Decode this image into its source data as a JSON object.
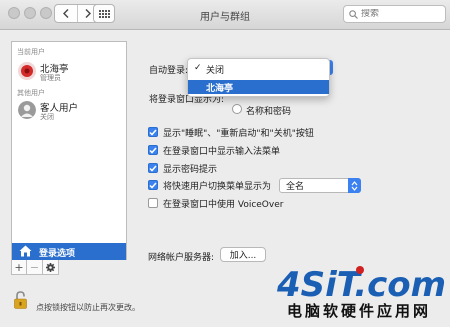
{
  "window": {
    "title": "用户与群组"
  },
  "search": {
    "placeholder": "搜索"
  },
  "sidebar": {
    "current_users_heading": "当前用户",
    "current_user": {
      "name": "北海亭",
      "role": "管理员"
    },
    "other_users_heading": "其他用户",
    "other_user": {
      "name": "客人用户",
      "status": "关闭"
    },
    "login_options_label": "登录选项",
    "add_label": "+",
    "remove_label": "−"
  },
  "login": {
    "auto_login_label": "自动登录:",
    "auto_login_menu": {
      "items": [
        {
          "label": "关闭",
          "checked": true
        },
        {
          "label": "北海亭",
          "selected": true
        }
      ]
    },
    "show_window_label": "将登录窗口显示为:",
    "radio_name_password": "名称和密码",
    "checkboxes": [
      {
        "label": "显示\"睡眠\"、\"重新启动\"和\"关机\"按钮",
        "checked": true
      },
      {
        "label": "在登录窗口中显示输入法菜单",
        "checked": true
      },
      {
        "label": "显示密码提示",
        "checked": true
      },
      {
        "label": "将快速用户切换菜单显示为",
        "checked": true
      },
      {
        "label": "在登录窗口中使用 VoiceOver",
        "checked": false
      }
    ],
    "fast_switch_value": "全名",
    "network_server_label": "网络帐户服务器:",
    "join_button": "加入..."
  },
  "lock": {
    "text": "点按锁按钮以防止再次更改。"
  },
  "watermark": {
    "logo": "4SiT.com",
    "subtitle": "电脑软硬件应用网"
  },
  "colors": {
    "accent": "#2b6fce",
    "checkbox": "#3b82f0",
    "watermark_blue": "#1a5fb4",
    "watermark_red": "#d02020"
  }
}
